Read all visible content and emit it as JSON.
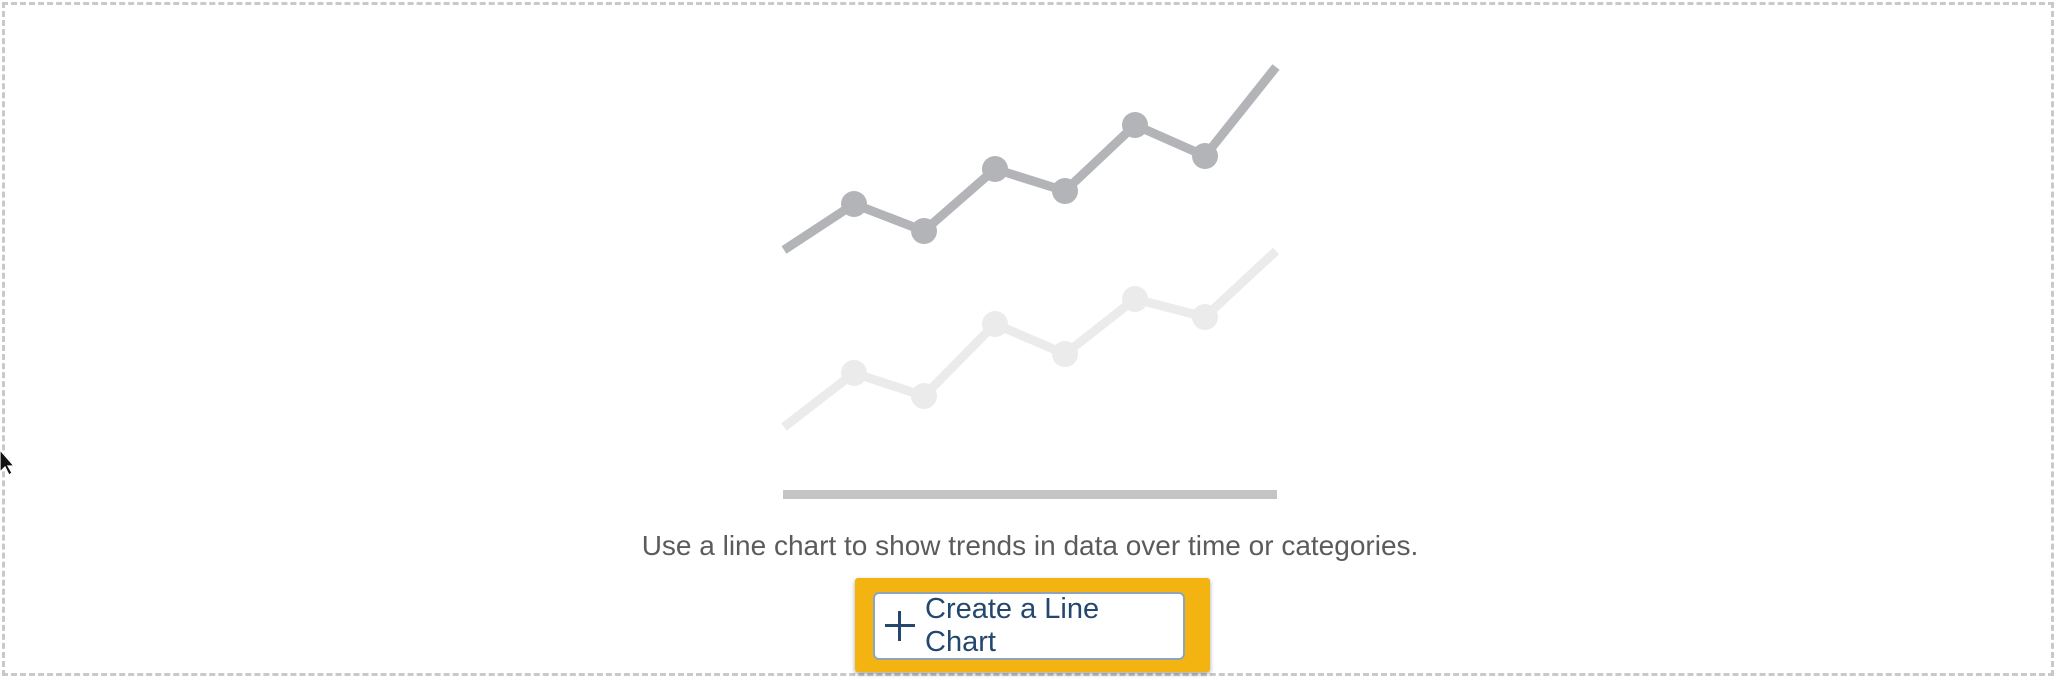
{
  "empty_state": {
    "description": "Use a line chart to show trends in data over time or categories.",
    "create_button_label": "Create a Line Chart"
  },
  "colors": {
    "line_primary": "#b3b4b7",
    "line_secondary": "#ebebec",
    "baseline": "#c4c4c6",
    "button_text": "#24476e",
    "highlight": "#f3b310"
  },
  "icons": {
    "create_button_icon": "plus-icon",
    "cursor": "mouse-pointer-icon"
  }
}
